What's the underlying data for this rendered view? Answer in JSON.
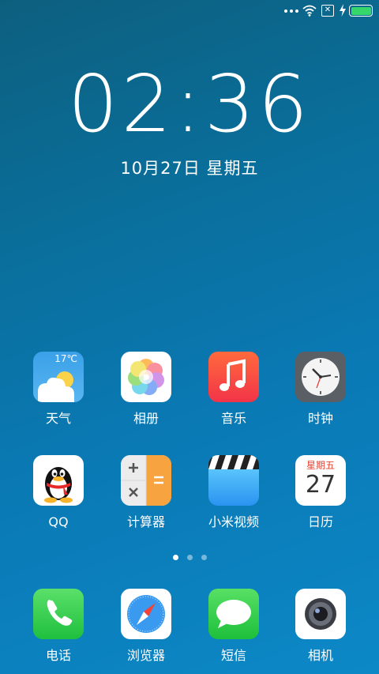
{
  "statusbar": {
    "sim_glyph": "✕",
    "battery_color": "#35d66a",
    "icons": [
      "more-dots-icon",
      "wifi-icon",
      "no-sim-icon",
      "charging-bolt-icon",
      "battery-icon"
    ]
  },
  "lockclock": {
    "time": "02:36",
    "date": "10月27日  星期五"
  },
  "apps": {
    "row1": [
      {
        "label": "天气",
        "temp": "17℃",
        "icon": "weather-icon"
      },
      {
        "label": "相册",
        "icon": "photos-icon"
      },
      {
        "label": "音乐",
        "icon": "music-note-icon"
      },
      {
        "label": "时钟",
        "icon": "clock-icon"
      }
    ],
    "row2": [
      {
        "label": "QQ",
        "icon": "qq-penguin-icon"
      },
      {
        "label": "计算器",
        "icon": "calculator-icon"
      },
      {
        "label": "小米视频",
        "icon": "clapperboard-icon"
      },
      {
        "label": "日历",
        "weekday": "星期五",
        "day": "27",
        "icon": "calendar-icon"
      }
    ],
    "dock": [
      {
        "label": "电话",
        "icon": "phone-icon"
      },
      {
        "label": "浏览器",
        "icon": "compass-icon"
      },
      {
        "label": "短信",
        "icon": "chat-bubble-icon"
      },
      {
        "label": "相机",
        "icon": "camera-icon"
      }
    ]
  },
  "pager": {
    "pages": 3,
    "active": 1
  }
}
